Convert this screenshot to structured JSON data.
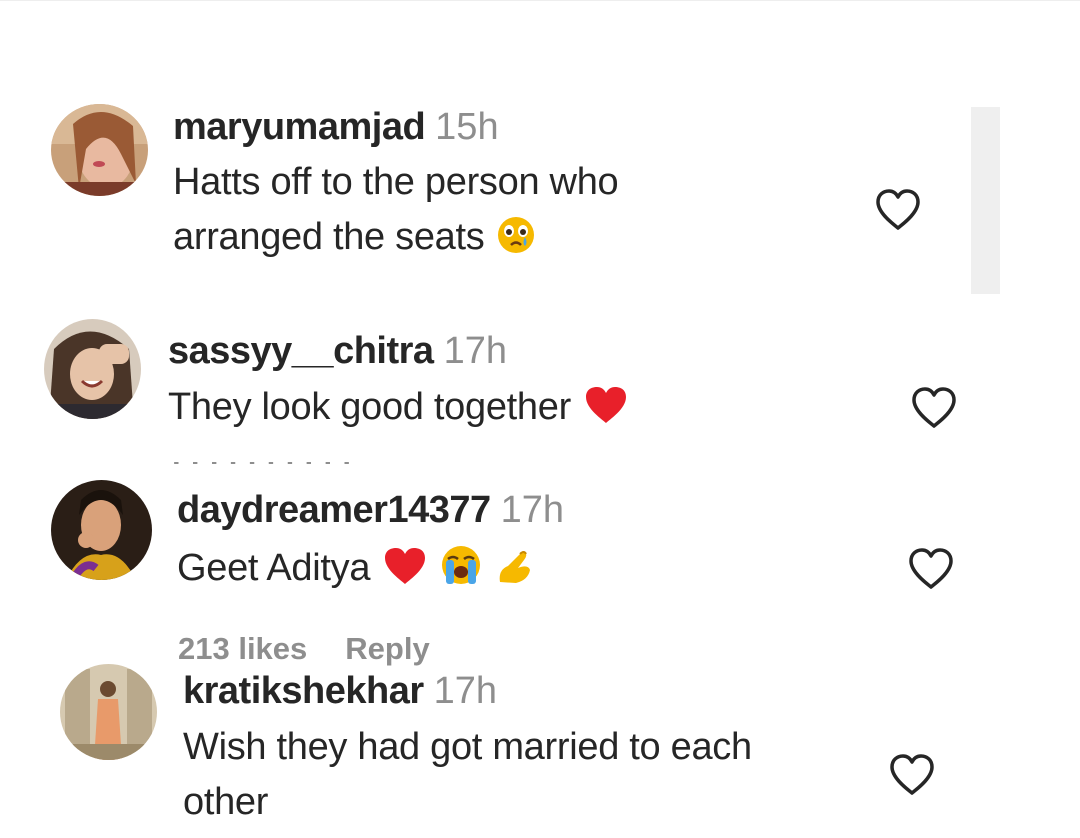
{
  "comments": [
    {
      "username": "maryumamjad",
      "time": "15h",
      "lines": [
        "Hatts off to the person who",
        "arranged the seats"
      ],
      "emoji": [
        "crying-face"
      ]
    },
    {
      "username": "sassyy__chitra",
      "time": "17h",
      "lines": [
        "They look good together"
      ],
      "emoji": [
        "red-heart"
      ]
    },
    {
      "username": "daydreamer14377",
      "time": "17h",
      "lines": [
        "Geet Aditya"
      ],
      "emoji": [
        "red-heart",
        "loudly-crying-face",
        "pinching-hand"
      ],
      "likes": "213 likes",
      "reply": "Reply"
    },
    {
      "username": "kratikshekhar",
      "time": "17h",
      "lines": [
        "Wish they had got married to each",
        "other"
      ]
    }
  ],
  "icons": {
    "like": "heart-outline-icon"
  },
  "colors": {
    "text": "#262626",
    "secondary": "#8e8e8e",
    "heart_red": "#e8202a",
    "emoji_yellow": "#f6b900",
    "scrollbar": "#efefef"
  }
}
